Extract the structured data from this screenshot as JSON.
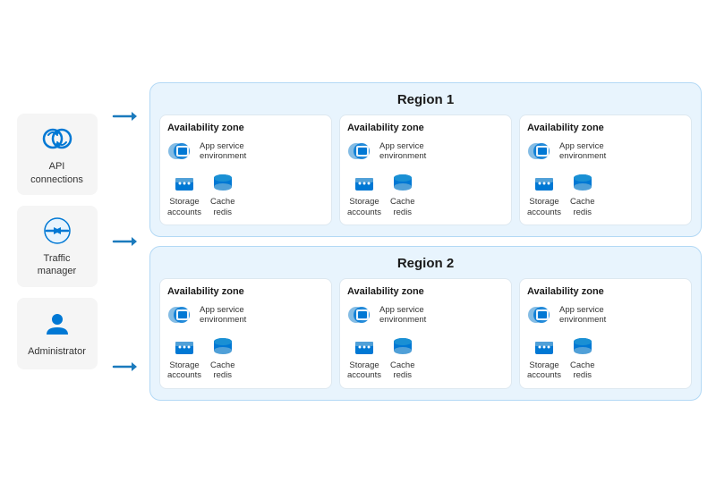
{
  "sidebar": {
    "items": [
      {
        "id": "api-connections",
        "label": "API\nconnections"
      },
      {
        "id": "traffic-manager",
        "label": "Traffic\nmanager"
      },
      {
        "id": "administrator",
        "label": "Administrator"
      }
    ]
  },
  "regions": [
    {
      "id": "region1",
      "title": "Region 1",
      "zones": [
        {
          "id": "z1a",
          "title": "Availability zone",
          "appService": "App service\nenvironment",
          "storage": "Storage\naccounts",
          "cache": "Cache\nredis"
        },
        {
          "id": "z1b",
          "title": "Availability zone",
          "appService": "App service\nenvironment",
          "storage": "Storage\naccounts",
          "cache": "Cache\nredis"
        },
        {
          "id": "z1c",
          "title": "Availability zone",
          "appService": "App service\nenvironment",
          "storage": "Storage\naccounts",
          "cache": "Cache\nredis"
        }
      ]
    },
    {
      "id": "region2",
      "title": "Region 2",
      "zones": [
        {
          "id": "z2a",
          "title": "Availability zone",
          "appService": "App service\nenvironment",
          "storage": "Storage\naccounts",
          "cache": "Cache\nredis"
        },
        {
          "id": "z2b",
          "title": "Availability zone",
          "appService": "App service\nenvironment",
          "storage": "Storage\naccounts",
          "cache": "Cache\nredis"
        },
        {
          "id": "z2c",
          "title": "Availability zone",
          "appService": "App service\nenvironment",
          "storage": "Storage\naccounts",
          "cache": "Cache\nredis"
        }
      ]
    }
  ],
  "colors": {
    "blue_dark": "#1a7abd",
    "blue_light": "#e8f4fd",
    "blue_icon": "#0078d4",
    "region_border": "#b3d9f5"
  }
}
